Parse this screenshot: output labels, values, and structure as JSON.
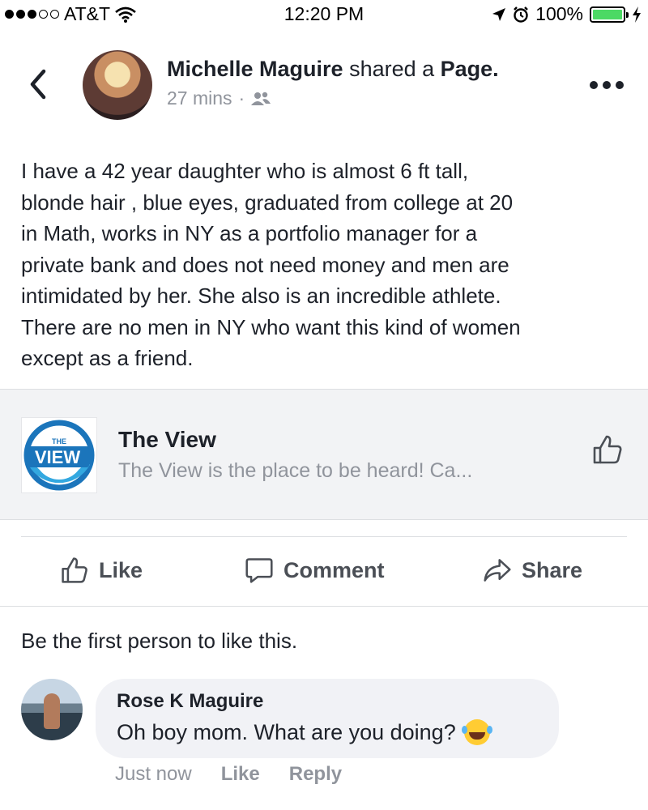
{
  "status_bar": {
    "carrier": "AT&T",
    "time": "12:20 PM",
    "battery": "100%",
    "battery_level": 1.0,
    "signal_bars_filled": 3,
    "signal_bars_total": 5
  },
  "post": {
    "author": "Michelle Maguire",
    "action_text": " shared a ",
    "object": "Page.",
    "time_ago": "27 mins",
    "separator": "·",
    "audience_icon": "friends-icon",
    "body": "I have a 42 year daughter who is almost 6 ft tall,\nblonde hair , blue eyes, graduated from college at 20\nin Math, works in NY as a portfolio manager for a\nprivate bank and does not need money and men are\nintimidated by her. She also is an incredible athlete.\nThere are no men in NY who want this kind of women\nexcept as a friend."
  },
  "shared_page": {
    "logo_top": "THE",
    "logo_main": "VIEW",
    "name": "The View",
    "description": "The View is the place to be heard! Ca..."
  },
  "actions": {
    "like": "Like",
    "comment": "Comment",
    "share": "Share"
  },
  "likes_summary": "Be the first person to like this.",
  "comment": {
    "author": "Rose K Maguire",
    "text": "Oh boy mom. What are you doing?",
    "emoji": "laughing-tears-emoji",
    "time": "Just now",
    "like": "Like",
    "reply": "Reply"
  },
  "colors": {
    "text": "#1d2129",
    "secondary": "#90949c",
    "card_bg": "#f2f3f5",
    "bubble_bg": "#f1f2f6",
    "battery_fill": "#4cd964"
  }
}
